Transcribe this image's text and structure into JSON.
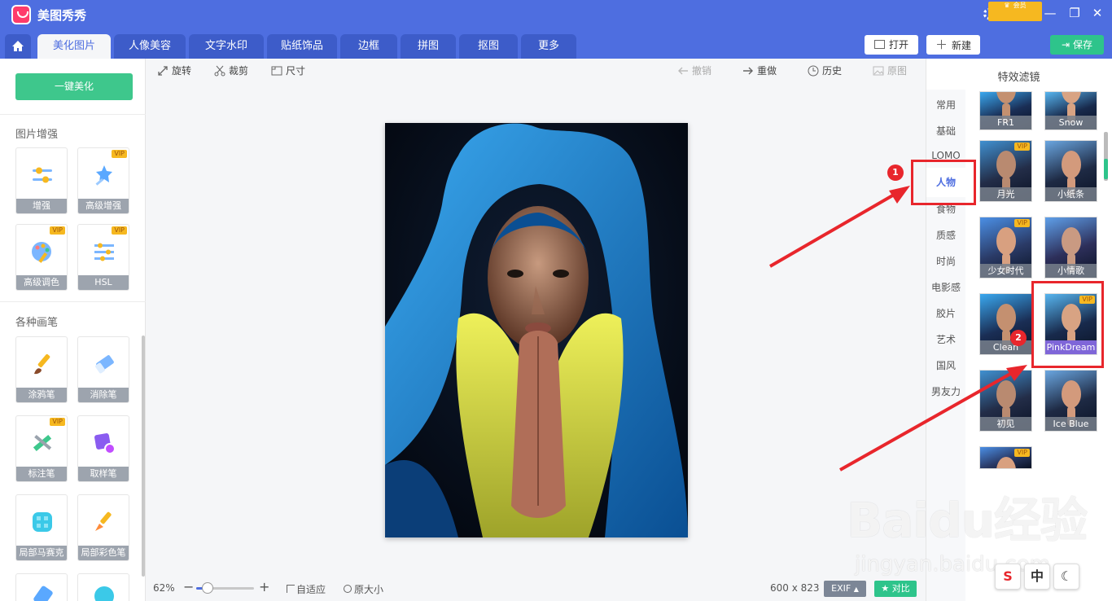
{
  "app": {
    "title": "美图秀秀",
    "settings_label": "设置"
  },
  "tabs": [
    "美化图片",
    "人像美容",
    "文字水印",
    "贴纸饰品",
    "边框",
    "拼图",
    "抠图",
    "更多"
  ],
  "header_buttons": {
    "open": "打开",
    "new": "新建",
    "vip": "会员",
    "save": "保存"
  },
  "left": {
    "one_key": "一键美化",
    "section_enhance": "图片增强",
    "enhance_tools": [
      {
        "label": "增强",
        "vip": false,
        "icon": "sliders-icon"
      },
      {
        "label": "高级增强",
        "vip": true,
        "icon": "magic-wand-icon"
      },
      {
        "label": "高级调色",
        "vip": true,
        "icon": "palette-icon"
      },
      {
        "label": "HSL",
        "vip": true,
        "icon": "hsl-sliders-icon"
      }
    ],
    "section_brush": "各种画笔",
    "brush_tools": [
      {
        "label": "涂鸦笔",
        "vip": false,
        "icon": "brush-icon"
      },
      {
        "label": "消除笔",
        "vip": false,
        "icon": "eraser-icon"
      },
      {
        "label": "标注笔",
        "vip": true,
        "icon": "marker-pen-icon"
      },
      {
        "label": "取样笔",
        "vip": false,
        "icon": "sampler-pen-icon"
      },
      {
        "label": "局部马赛克",
        "vip": false,
        "icon": "mosaic-icon"
      },
      {
        "label": "局部彩色笔",
        "vip": false,
        "icon": "color-brush-icon"
      }
    ],
    "vip_badge": "VIP"
  },
  "toolbar": {
    "rotate": "旋转",
    "crop": "裁剪",
    "size": "尺寸",
    "undo": "撤销",
    "redo": "重做",
    "history": "历史",
    "original": "原图"
  },
  "bottom": {
    "zoom": "62%",
    "fit": "自适应",
    "actual": "原大小",
    "dimensions": "600 x 823",
    "exif": "EXIF",
    "compare": "对比"
  },
  "right": {
    "title": "特效滤镜",
    "categories": [
      "常用",
      "基础",
      "LOMO",
      "人物",
      "食物",
      "质感",
      "时尚",
      "电影感",
      "胶片",
      "艺术",
      "国风",
      "男友力"
    ],
    "active_category": "人物",
    "filters": [
      {
        "label": "FR1",
        "vip": false
      },
      {
        "label": "Snow",
        "vip": false
      },
      {
        "label": "月光",
        "vip": true
      },
      {
        "label": "小纸条",
        "vip": false
      },
      {
        "label": "少女时代",
        "vip": true
      },
      {
        "label": "小情歌",
        "vip": false
      },
      {
        "label": "Clean",
        "vip": false
      },
      {
        "label": "PinkDream",
        "vip": true
      },
      {
        "label": "初见",
        "vip": false
      },
      {
        "label": "Ice Blue",
        "vip": false
      },
      {
        "label": "",
        "vip": true
      }
    ]
  },
  "annotations": {
    "step1": "1",
    "step2": "2"
  },
  "watermark": {
    "brand": "Baidu经验",
    "url": "jingyan.baidu.com"
  },
  "ime": {
    "btn2": "中"
  },
  "colors": {
    "titlebar": "#4e6ee0",
    "accent_green": "#3ec78c",
    "vip_gold": "#f6b820",
    "annotation_red": "#e8262c"
  }
}
